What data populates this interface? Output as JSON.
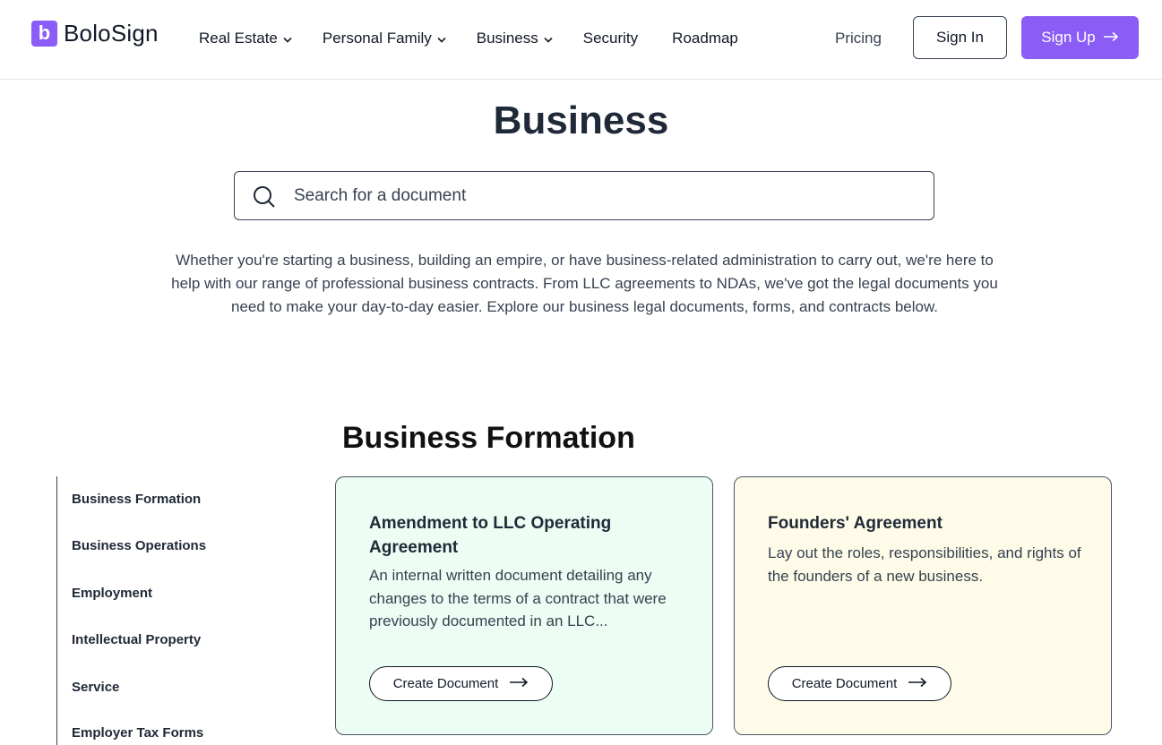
{
  "brand": {
    "logo_letter": "b",
    "name": "BoloSign",
    "accent": "#8b5cf6"
  },
  "nav": {
    "items": [
      {
        "label": "Real Estate",
        "dropdown": true
      },
      {
        "label": "Personal Family",
        "dropdown": true
      },
      {
        "label": "Business",
        "dropdown": true
      },
      {
        "label": "Security",
        "dropdown": false
      },
      {
        "label": "Roadmap",
        "dropdown": false
      }
    ],
    "pricing": "Pricing",
    "sign_in": "Sign In",
    "sign_up": "Sign Up"
  },
  "page": {
    "title": "Business",
    "search_placeholder": "Search for a document",
    "intro": "Whether you're starting a business, building an empire, or have business-related administration to carry out, we're here to help with our range of professional business contracts. From LLC agreements to NDAs, we've got the legal documents you need to make your day-to-day easier. Explore our business legal documents, forms, and contracts below."
  },
  "section": {
    "title": "Business Formation"
  },
  "sidebar": {
    "items": [
      "Business Formation",
      "Business Operations",
      "Employment",
      "Intellectual Property",
      "Service",
      "Employer Tax Forms"
    ]
  },
  "cards": [
    {
      "title": "Amendment to LLC Operating Agreement",
      "description": "An internal written document detailing any changes to the terms of a contract that were previously documented in an LLC...",
      "button": "Create Document",
      "background": "#ecfdf3"
    },
    {
      "title": "Founders' Agreement",
      "description": "Lay out the roles, responsibilities, and rights of the founders of a new business.",
      "button": "Create Document",
      "background": "#fefce8"
    }
  ]
}
